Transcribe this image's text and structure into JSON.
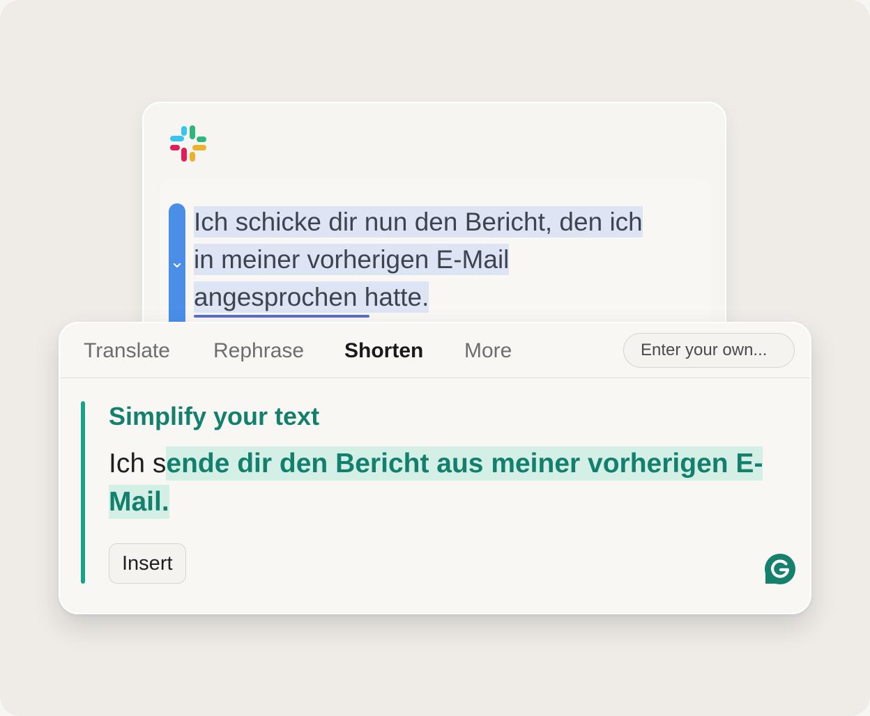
{
  "slack": {
    "logo_icon": "slack-logo-icon",
    "message": {
      "line1": "Ich schicke dir nun den Bericht, den ich",
      "line2": "in meiner vorherigen E-Mail",
      "line3": "angesprochen hatte."
    }
  },
  "panel": {
    "tabs": [
      {
        "label": "Translate"
      },
      {
        "label": "Rephrase"
      },
      {
        "label": "Shorten"
      },
      {
        "label": "More"
      }
    ],
    "active_tab": "Shorten",
    "custom_prompt": {
      "placeholder": "Enter your own..."
    },
    "suggestion": {
      "title": "Simplify your text",
      "kept_text": "Ich s",
      "inserted_text": "ende dir den Bericht aus meiner vorherigen E-Mail.",
      "insert_label": "Insert"
    },
    "brand_icon": "grammarly-logo-icon"
  },
  "colors": {
    "accent_green": "#12806c",
    "accent_bar": "#18a388",
    "grammarly_blue": "#4a8ee8",
    "selection_highlight": "#dde5f4",
    "insert_highlight": "#d3efe6"
  }
}
